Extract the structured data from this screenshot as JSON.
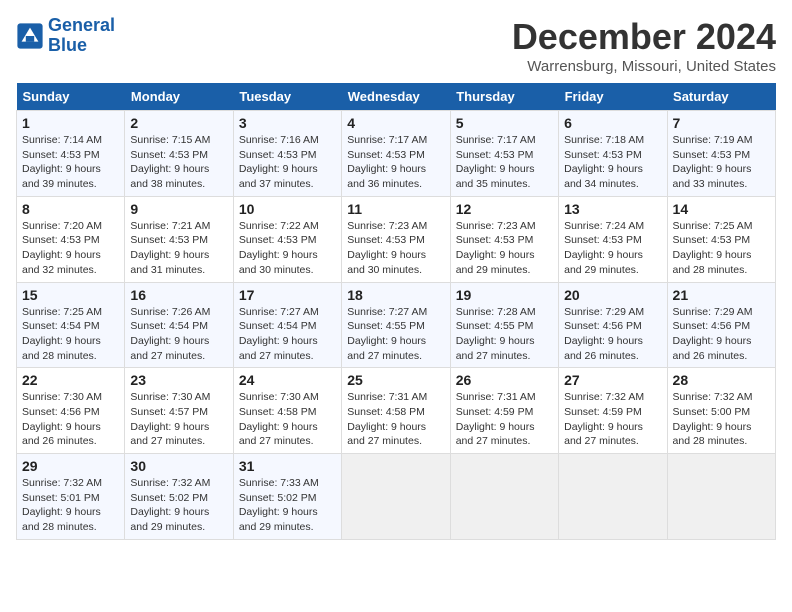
{
  "header": {
    "logo_line1": "General",
    "logo_line2": "Blue",
    "month": "December 2024",
    "location": "Warrensburg, Missouri, United States"
  },
  "days_of_week": [
    "Sunday",
    "Monday",
    "Tuesday",
    "Wednesday",
    "Thursday",
    "Friday",
    "Saturday"
  ],
  "weeks": [
    [
      {
        "day": "1",
        "info": "Sunrise: 7:14 AM\nSunset: 4:53 PM\nDaylight: 9 hours\nand 39 minutes."
      },
      {
        "day": "2",
        "info": "Sunrise: 7:15 AM\nSunset: 4:53 PM\nDaylight: 9 hours\nand 38 minutes."
      },
      {
        "day": "3",
        "info": "Sunrise: 7:16 AM\nSunset: 4:53 PM\nDaylight: 9 hours\nand 37 minutes."
      },
      {
        "day": "4",
        "info": "Sunrise: 7:17 AM\nSunset: 4:53 PM\nDaylight: 9 hours\nand 36 minutes."
      },
      {
        "day": "5",
        "info": "Sunrise: 7:17 AM\nSunset: 4:53 PM\nDaylight: 9 hours\nand 35 minutes."
      },
      {
        "day": "6",
        "info": "Sunrise: 7:18 AM\nSunset: 4:53 PM\nDaylight: 9 hours\nand 34 minutes."
      },
      {
        "day": "7",
        "info": "Sunrise: 7:19 AM\nSunset: 4:53 PM\nDaylight: 9 hours\nand 33 minutes."
      }
    ],
    [
      {
        "day": "8",
        "info": "Sunrise: 7:20 AM\nSunset: 4:53 PM\nDaylight: 9 hours\nand 32 minutes."
      },
      {
        "day": "9",
        "info": "Sunrise: 7:21 AM\nSunset: 4:53 PM\nDaylight: 9 hours\nand 31 minutes."
      },
      {
        "day": "10",
        "info": "Sunrise: 7:22 AM\nSunset: 4:53 PM\nDaylight: 9 hours\nand 30 minutes."
      },
      {
        "day": "11",
        "info": "Sunrise: 7:23 AM\nSunset: 4:53 PM\nDaylight: 9 hours\nand 30 minutes."
      },
      {
        "day": "12",
        "info": "Sunrise: 7:23 AM\nSunset: 4:53 PM\nDaylight: 9 hours\nand 29 minutes."
      },
      {
        "day": "13",
        "info": "Sunrise: 7:24 AM\nSunset: 4:53 PM\nDaylight: 9 hours\nand 29 minutes."
      },
      {
        "day": "14",
        "info": "Sunrise: 7:25 AM\nSunset: 4:53 PM\nDaylight: 9 hours\nand 28 minutes."
      }
    ],
    [
      {
        "day": "15",
        "info": "Sunrise: 7:25 AM\nSunset: 4:54 PM\nDaylight: 9 hours\nand 28 minutes."
      },
      {
        "day": "16",
        "info": "Sunrise: 7:26 AM\nSunset: 4:54 PM\nDaylight: 9 hours\nand 27 minutes."
      },
      {
        "day": "17",
        "info": "Sunrise: 7:27 AM\nSunset: 4:54 PM\nDaylight: 9 hours\nand 27 minutes."
      },
      {
        "day": "18",
        "info": "Sunrise: 7:27 AM\nSunset: 4:55 PM\nDaylight: 9 hours\nand 27 minutes."
      },
      {
        "day": "19",
        "info": "Sunrise: 7:28 AM\nSunset: 4:55 PM\nDaylight: 9 hours\nand 27 minutes."
      },
      {
        "day": "20",
        "info": "Sunrise: 7:29 AM\nSunset: 4:56 PM\nDaylight: 9 hours\nand 26 minutes."
      },
      {
        "day": "21",
        "info": "Sunrise: 7:29 AM\nSunset: 4:56 PM\nDaylight: 9 hours\nand 26 minutes."
      }
    ],
    [
      {
        "day": "22",
        "info": "Sunrise: 7:30 AM\nSunset: 4:56 PM\nDaylight: 9 hours\nand 26 minutes."
      },
      {
        "day": "23",
        "info": "Sunrise: 7:30 AM\nSunset: 4:57 PM\nDaylight: 9 hours\nand 27 minutes."
      },
      {
        "day": "24",
        "info": "Sunrise: 7:30 AM\nSunset: 4:58 PM\nDaylight: 9 hours\nand 27 minutes."
      },
      {
        "day": "25",
        "info": "Sunrise: 7:31 AM\nSunset: 4:58 PM\nDaylight: 9 hours\nand 27 minutes."
      },
      {
        "day": "26",
        "info": "Sunrise: 7:31 AM\nSunset: 4:59 PM\nDaylight: 9 hours\nand 27 minutes."
      },
      {
        "day": "27",
        "info": "Sunrise: 7:32 AM\nSunset: 4:59 PM\nDaylight: 9 hours\nand 27 minutes."
      },
      {
        "day": "28",
        "info": "Sunrise: 7:32 AM\nSunset: 5:00 PM\nDaylight: 9 hours\nand 28 minutes."
      }
    ],
    [
      {
        "day": "29",
        "info": "Sunrise: 7:32 AM\nSunset: 5:01 PM\nDaylight: 9 hours\nand 28 minutes."
      },
      {
        "day": "30",
        "info": "Sunrise: 7:32 AM\nSunset: 5:02 PM\nDaylight: 9 hours\nand 29 minutes."
      },
      {
        "day": "31",
        "info": "Sunrise: 7:33 AM\nSunset: 5:02 PM\nDaylight: 9 hours\nand 29 minutes."
      },
      {
        "day": "",
        "info": ""
      },
      {
        "day": "",
        "info": ""
      },
      {
        "day": "",
        "info": ""
      },
      {
        "day": "",
        "info": ""
      }
    ]
  ]
}
